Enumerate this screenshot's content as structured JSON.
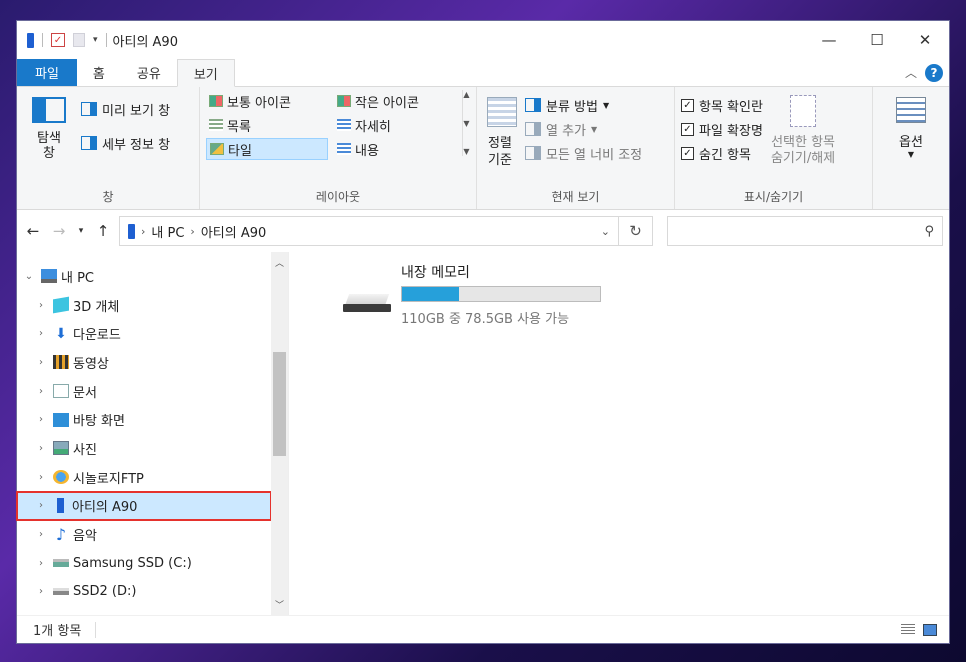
{
  "window": {
    "title": "아티의 A90",
    "minimize": "—",
    "maximize": "☐",
    "close": "✕"
  },
  "ribbon_tabs": {
    "file": "파일",
    "home": "홈",
    "share": "공유",
    "view": "보기"
  },
  "ribbon": {
    "pane": {
      "nav_pane": "탐색\n창",
      "preview_pane": "미리 보기 창",
      "details_pane": "세부 정보 창",
      "label": "창"
    },
    "layout": {
      "items": [
        "보통 아이콘",
        "작은 아이콘",
        "목록",
        "자세히",
        "타일",
        "내용"
      ],
      "selected": "타일",
      "label": "레이아웃"
    },
    "current_view": {
      "sort": "정렬\n기준",
      "group_by": "분류 방법",
      "add_columns": "열 추가",
      "fit_columns": "모든 열 너비 조정",
      "label": "현재 보기"
    },
    "show_hide": {
      "item_checkboxes": "항목 확인란",
      "file_extensions": "파일 확장명",
      "hidden_items": "숨긴 항목",
      "hide_selected": "선택한 항목\n숨기기/해제",
      "label": "표시/숨기기"
    },
    "options": {
      "label": "옵션"
    }
  },
  "address": {
    "path": [
      "내 PC",
      "아티의 A90"
    ]
  },
  "tree": {
    "items": [
      {
        "label": "내 PC",
        "expanded": true,
        "icon": "pc-icon",
        "level": 0
      },
      {
        "label": "3D 개체",
        "icon": "cube-icon",
        "level": 1
      },
      {
        "label": "다운로드",
        "icon": "download-icon",
        "level": 1
      },
      {
        "label": "동영상",
        "icon": "video-icon",
        "level": 1
      },
      {
        "label": "문서",
        "icon": "document-icon",
        "level": 1
      },
      {
        "label": "바탕 화면",
        "icon": "desktop-icon",
        "level": 1
      },
      {
        "label": "사진",
        "icon": "picture-icon",
        "level": 1
      },
      {
        "label": "시놀로지FTP",
        "icon": "network-icon",
        "level": 1
      },
      {
        "label": "아티의 A90",
        "icon": "phone-icon",
        "level": 1,
        "selected": true
      },
      {
        "label": "음악",
        "icon": "music-icon",
        "level": 1
      },
      {
        "label": "Samsung SSD (C:)",
        "icon": "ssd-icon",
        "level": 1
      },
      {
        "label": "SSD2 (D:)",
        "icon": "drive-icon",
        "level": 1
      }
    ]
  },
  "content": {
    "storage_name": "내장 메모리",
    "usage_text": "110GB 중 78.5GB 사용 가능",
    "used_fraction": 0.286
  },
  "status": {
    "count": "1개 항목"
  },
  "colors": {
    "accent": "#1979ca",
    "selection": "#cce8ff",
    "highlight_border": "#e5322d",
    "bar_fill": "#26a0da"
  }
}
